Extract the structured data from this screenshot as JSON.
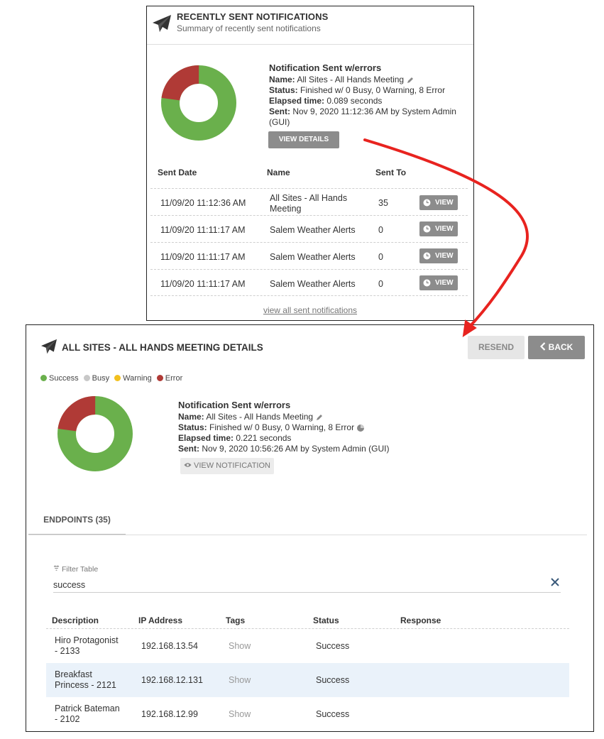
{
  "recent": {
    "title": "RECENTLY SENT NOTIFICATIONS",
    "subtitle": "Summary of recently sent notifications",
    "summary": {
      "heading": "Notification Sent w/errors",
      "name_label": "Name:",
      "name_value": "All Sites - All Hands Meeting",
      "status_label": "Status:",
      "status_value": "Finished w/ 0 Busy, 0 Warning, 8 Error",
      "elapsed_label": "Elapsed time:",
      "elapsed_value": "0.089 seconds",
      "sent_label": "Sent:",
      "sent_value_line1": "Nov 9, 2020 11:12:36 AM by System Admin",
      "sent_value_line2": "(GUI)",
      "donut": {
        "success": 27,
        "error": 8
      }
    },
    "view_details_label": "VIEW DETAILS",
    "columns": [
      "Sent Date",
      "Name",
      "Sent To"
    ],
    "rows": [
      {
        "date": "11/09/20 11:12:36 AM",
        "name_line1": "All Sites - All Hands",
        "name_line2": "Meeting",
        "sent_to": "35",
        "action": "VIEW"
      },
      {
        "date": "11/09/20 11:11:17 AM",
        "name_line1": "Salem Weather Alerts",
        "name_line2": "",
        "sent_to": "0",
        "action": "VIEW"
      },
      {
        "date": "11/09/20 11:11:17 AM",
        "name_line1": "Salem Weather Alerts",
        "name_line2": "",
        "sent_to": "0",
        "action": "VIEW"
      },
      {
        "date": "11/09/20 11:11:17 AM",
        "name_line1": "Salem Weather Alerts",
        "name_line2": "",
        "sent_to": "0",
        "action": "VIEW"
      }
    ],
    "view_all_label": "view all sent notifications"
  },
  "details": {
    "title": "ALL SITES - ALL HANDS MEETING DETAILS",
    "resend_label": "RESEND",
    "back_label": "BACK",
    "legend": [
      {
        "label": "Success",
        "color": "#6ab04c"
      },
      {
        "label": "Busy",
        "color": "#c8c8c8"
      },
      {
        "label": "Warning",
        "color": "#f2c01e"
      },
      {
        "label": "Error",
        "color": "#b03a36"
      }
    ],
    "summary": {
      "heading": "Notification Sent w/errors",
      "name_label": "Name:",
      "name_value": "All Sites - All Hands Meeting",
      "status_label": "Status:",
      "status_value": "Finished w/ 0 Busy, 0 Warning, 8 Error",
      "elapsed_label": "Elapsed time:",
      "elapsed_value": "0.221 seconds",
      "sent_label": "Sent:",
      "sent_value": "Nov 9, 2020 10:56:26 AM by System Admin (GUI)",
      "donut": {
        "success": 27,
        "error": 8
      }
    },
    "view_notification_label": "VIEW NOTIFICATION",
    "tab_label": "ENDPOINTS (35)",
    "filter_label": "Filter Table",
    "filter_value": "success",
    "columns": [
      "Description",
      "IP Address",
      "Tags",
      "Status",
      "Response"
    ],
    "rows": [
      {
        "desc_line1": "Hiro Protagonist",
        "desc_line2": "- 2133",
        "ip": "192.168.13.54",
        "tags": "Show",
        "status": "Success"
      },
      {
        "desc_line1": "Breakfast",
        "desc_line2": "Princess - 2121",
        "ip": "192.168.12.131",
        "tags": "Show",
        "status": "Success"
      },
      {
        "desc_line1": "Patrick Bateman",
        "desc_line2": "- 2102",
        "ip": "192.168.12.99",
        "tags": "Show",
        "status": "Success"
      }
    ]
  },
  "colors": {
    "success": "#6ab04c",
    "error": "#b03a36",
    "button_gray": "#8c8c8c",
    "arrow": "#e8231f"
  }
}
